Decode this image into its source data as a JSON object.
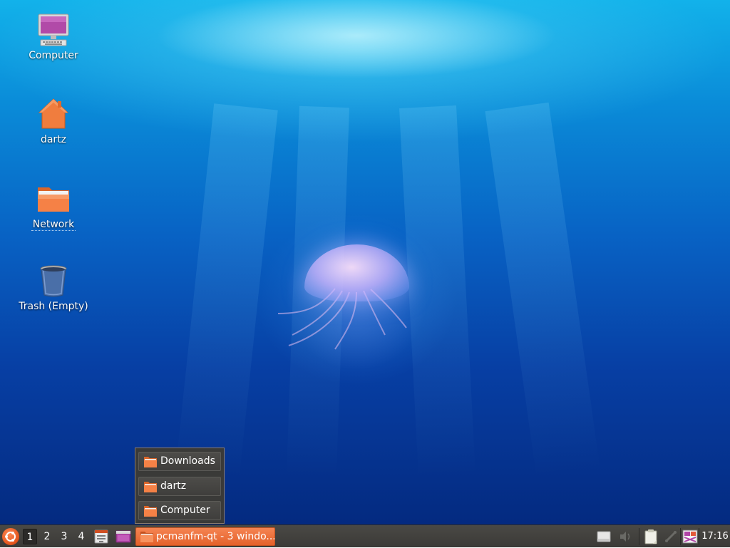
{
  "desktop": {
    "icons": [
      {
        "label": "Computer",
        "icon": "computer-icon"
      },
      {
        "label": "dartz",
        "icon": "home-folder-icon"
      },
      {
        "label": "Network",
        "icon": "network-folder-icon"
      },
      {
        "label": "Trash (Empty)",
        "icon": "trash-icon"
      }
    ],
    "wallpaper": "jellyfish-underwater"
  },
  "stack_popup": {
    "items": [
      {
        "label": "Downloads",
        "icon": "folder-icon"
      },
      {
        "label": "dartz",
        "icon": "folder-icon"
      },
      {
        "label": "Computer",
        "icon": "folder-icon"
      }
    ]
  },
  "taskbar": {
    "start_icon": "ubuntu-menu-icon",
    "desktops": [
      "1",
      "2",
      "3",
      "4"
    ],
    "active_desktop": "1",
    "quicklaunch": [
      {
        "icon": "file-manager-icon"
      },
      {
        "icon": "terminal-window-icon"
      }
    ],
    "task": {
      "label": "pcmanfm-qt - 3 windo...",
      "icon": "folder-icon"
    },
    "tray": [
      {
        "icon": "drive-icon"
      },
      {
        "icon": "volume-muted-icon"
      },
      {
        "icon": "clipboard-icon"
      },
      {
        "icon": "network-disconnected-icon"
      },
      {
        "icon": "screenshot-app-icon"
      }
    ],
    "clock": "17:16"
  },
  "colors": {
    "accent": "#e8642c",
    "panel": "#3f3e3b",
    "folder": "#f07d3e"
  }
}
